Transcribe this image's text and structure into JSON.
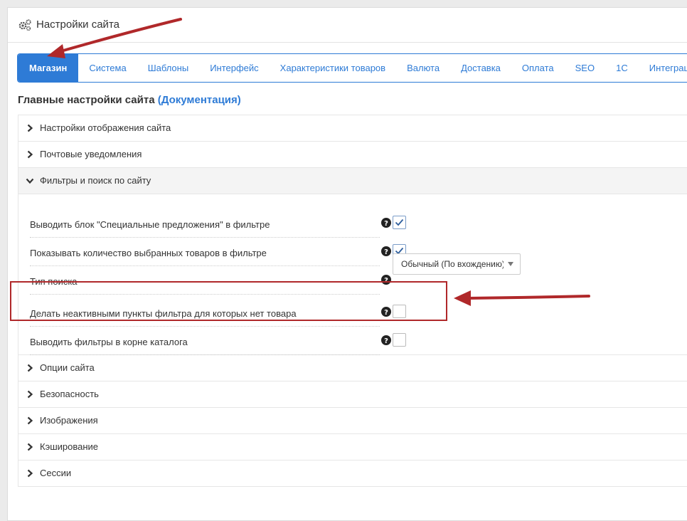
{
  "header": {
    "title": "Настройки сайта",
    "icon": "gears-icon"
  },
  "tabs": [
    {
      "label": "Магазин",
      "active": true
    },
    {
      "label": "Система"
    },
    {
      "label": "Шаблоны"
    },
    {
      "label": "Интерфейс"
    },
    {
      "label": "Характеристики товаров"
    },
    {
      "label": "Валюта"
    },
    {
      "label": "Доставка"
    },
    {
      "label": "Оплата"
    },
    {
      "label": "SEO"
    },
    {
      "label": "1С"
    },
    {
      "label": "Интеграция"
    }
  ],
  "main": {
    "heading": "Главные настройки сайта",
    "doc_link": "(Документация)"
  },
  "sections": {
    "display": "Настройки отображения сайта",
    "mail": "Почтовые уведомления",
    "filters": "Фильтры и поиск по сайту",
    "options": "Опции сайта",
    "security": "Безопасность",
    "images": "Изображения",
    "cache": "Кэширование",
    "sessions": "Сессии"
  },
  "filters": {
    "special_offers": {
      "label": "Выводить блок \"Специальные предложения\" в фильтре",
      "checked": true
    },
    "count_selected": {
      "label": "Показывать количество выбранных товаров в фильтре",
      "checked": true
    },
    "search_type": {
      "label": "Тип поиска",
      "value": "Обычный (По вхождению)"
    },
    "inactive_items": {
      "label": "Делать неактивными пункты фильтра для которых нет товара",
      "checked": false
    },
    "root_catalog": {
      "label": "Выводить фильтры в корне каталога",
      "checked": false
    }
  },
  "colors": {
    "accent": "#2e7bd6",
    "annotation": "#b0282a"
  }
}
